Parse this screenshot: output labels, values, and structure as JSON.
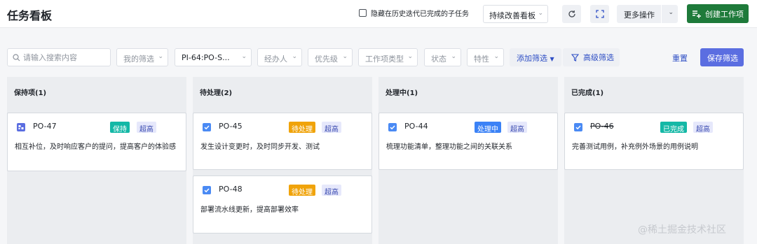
{
  "header": {
    "title": "任务看板",
    "hide_completed_label": "隐藏在历史迭代已完成的子任务",
    "board_select": "持续改善看板",
    "more_actions": "更多操作",
    "create_item": "创建工作项"
  },
  "filters": {
    "search_placeholder": "请输入搜索内容",
    "my_filter": "我的筛选",
    "iteration": "PI-64:PO-S...",
    "assignee": "经办人",
    "priority": "优先级",
    "item_type": "工作项类型",
    "status": "状态",
    "attribute": "特性",
    "add_filter": "添加筛选",
    "advanced_filter": "高级筛选",
    "reset": "重置",
    "save_filter": "保存筛选"
  },
  "columns": [
    {
      "title": "保持项(1)",
      "cards": [
        {
          "id": "PO-47",
          "status": "保持",
          "status_color": "#14b8a6",
          "priority": "超高",
          "icon": "requirement-icon",
          "desc": "相互补位，及时响应客户的提问，提高客户的体验感"
        }
      ]
    },
    {
      "title": "待处理(2)",
      "cards": [
        {
          "id": "PO-45",
          "status": "待处理",
          "status_color": "#f0a30a",
          "priority": "超高",
          "icon": "task-check-icon",
          "desc": "发生设计变更时，及时同步开发、测试"
        },
        {
          "id": "PO-48",
          "status": "待处理",
          "status_color": "#f0a30a",
          "priority": "超高",
          "icon": "task-check-icon",
          "desc": "部署流水线更新，提高部署效率"
        }
      ]
    },
    {
      "title": "处理中(1)",
      "cards": [
        {
          "id": "PO-44",
          "status": "处理中",
          "status_color": "#3b82f6",
          "priority": "超高",
          "icon": "task-check-icon",
          "desc": "梳理功能清单，整理功能之间的关联关系"
        }
      ]
    },
    {
      "title": "已完成(1)",
      "cards": [
        {
          "id": "PO-46",
          "status": "已完成",
          "status_color": "#14b8a6",
          "priority": "超高",
          "icon": "task-check-icon",
          "desc": "完善测试用例，补充例外场景的用例说明"
        }
      ]
    }
  ],
  "watermark": "@稀土掘金技术社区",
  "colors": {
    "accent": "#5b6ee1",
    "create_button": "#1e7a3a",
    "task_icon": "#4a8af4"
  }
}
